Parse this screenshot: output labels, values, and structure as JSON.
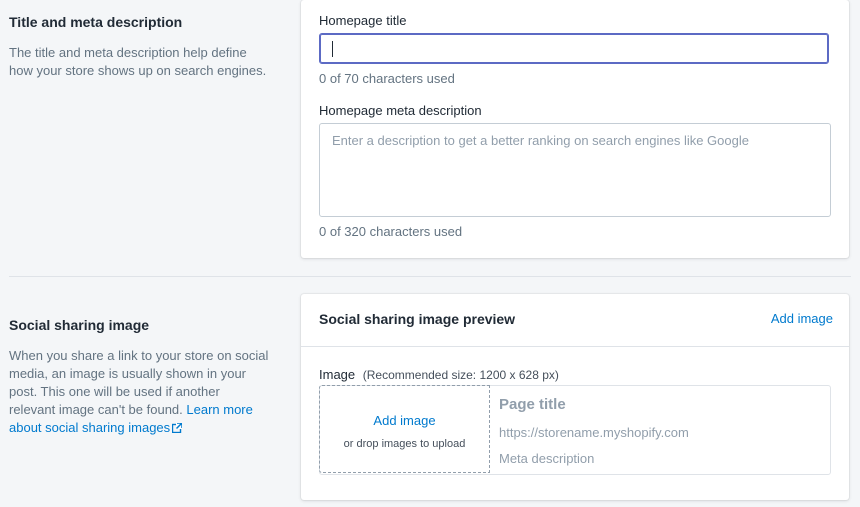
{
  "title_meta": {
    "heading": "Title and meta description",
    "description": "The title and meta description help define how your store shows up on search engines.",
    "homepage_title_label": "Homepage title",
    "homepage_title_value": "",
    "homepage_title_count": "0 of 70 characters used",
    "meta_desc_label": "Homepage meta description",
    "meta_desc_placeholder": "Enter a description to get a better ranking on search engines like Google",
    "meta_desc_count": "0 of 320 characters used"
  },
  "social": {
    "heading": "Social sharing image",
    "description": "When you share a link to your store on social media, an image is usually shown in your post. This one will be used if another relevant image can't be found.",
    "learn_more": "Learn more about social sharing images",
    "card_title": "Social sharing image preview",
    "add_image_action": "Add image",
    "image_label": "Image",
    "image_recommended": "(Recommended size: 1200 x 628 px)",
    "dropzone_add": "Add image",
    "dropzone_hint": "or drop images to upload",
    "preview_title": "Page title",
    "preview_url": "https://storename.myshopify.com",
    "preview_desc": "Meta description"
  },
  "icons": {
    "external_link": "external-link-icon"
  },
  "colors": {
    "link": "#007ace",
    "focus": "#5c6ac4",
    "background": "#f4f6f8"
  }
}
